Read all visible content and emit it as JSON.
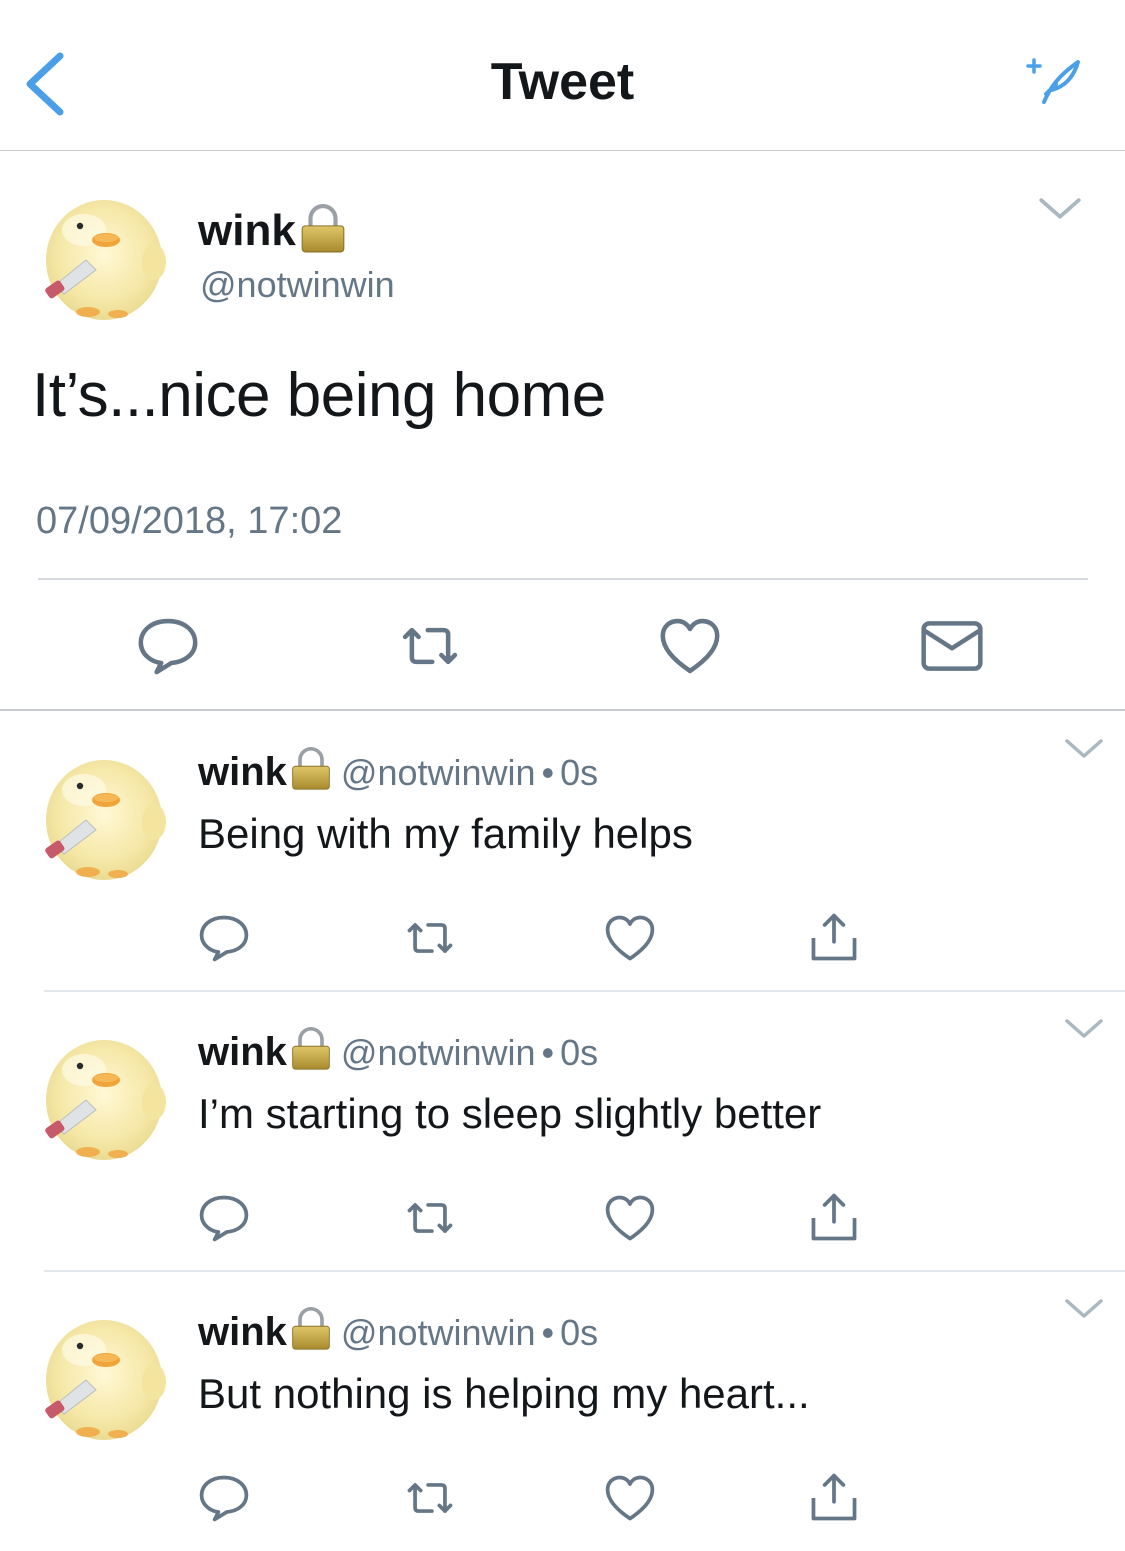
{
  "header": {
    "title": "Tweet",
    "back_icon": "chevron-left-icon",
    "compose_icon": "compose-tweet-icon",
    "accent_color": "#4a9fe8"
  },
  "main_tweet": {
    "name": "wink",
    "handle": "@notwinwin",
    "text": "It’s...nice being home",
    "timestamp": "07/09/2018, 17:02",
    "protected": true,
    "actions": [
      "reply-icon",
      "retweet-icon",
      "like-icon",
      "direct-message-icon"
    ]
  },
  "replies": [
    {
      "name": "wink",
      "handle": "@notwinwin",
      "separator": "•",
      "time": "0s",
      "text": "Being with my family helps",
      "protected": true
    },
    {
      "name": "wink",
      "handle": "@notwinwin",
      "separator": "•",
      "time": "0s",
      "text": "I’m starting to sleep slightly better",
      "protected": true
    },
    {
      "name": "wink",
      "handle": "@notwinwin",
      "separator": "•",
      "time": "0s",
      "text": "But nothing is helping my heart...",
      "protected": true
    }
  ],
  "colors": {
    "text_primary": "#14171a",
    "text_secondary": "#657786",
    "icon_gray": "#657786",
    "divider": "#c8ccd1"
  }
}
